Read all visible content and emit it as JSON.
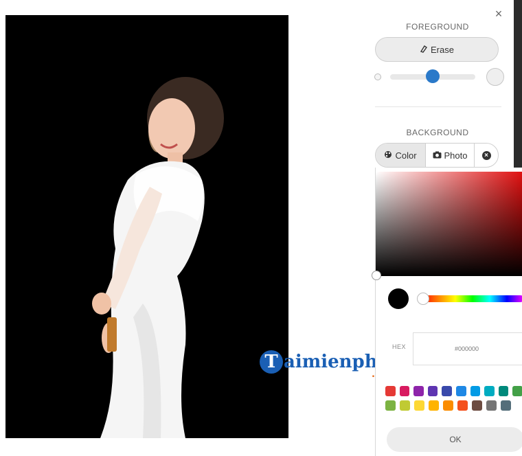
{
  "panel": {
    "close_label": "×",
    "foreground_title": "FOREGROUND",
    "erase_label": "Erase",
    "background_title": "BACKGROUND",
    "tabs": {
      "color_label": "Color",
      "photo_label": "Photo"
    }
  },
  "picker": {
    "current_color": "#000000",
    "hex_label": "HEX",
    "hex_value": "#000000",
    "swatches_row1": [
      "#e53935",
      "#d81b60",
      "#8e24aa",
      "#5e35b1",
      "#3949ab",
      "#1e88e5",
      "#039be5",
      "#00acc1",
      "#00897b",
      "#43a047"
    ],
    "swatches_row2": [
      "#7cb342",
      "#c0ca33",
      "#fdd835",
      "#ffb300",
      "#fb8c00",
      "#f4511e",
      "#6d4c41",
      "#757575",
      "#546e7a"
    ],
    "ok_label": "OK"
  },
  "watermark": {
    "letter": "T",
    "text": "aimienphi",
    "suffix": ".vn"
  },
  "colors": {
    "accent": "#2a79c9",
    "brand": "#1a5fb4"
  }
}
